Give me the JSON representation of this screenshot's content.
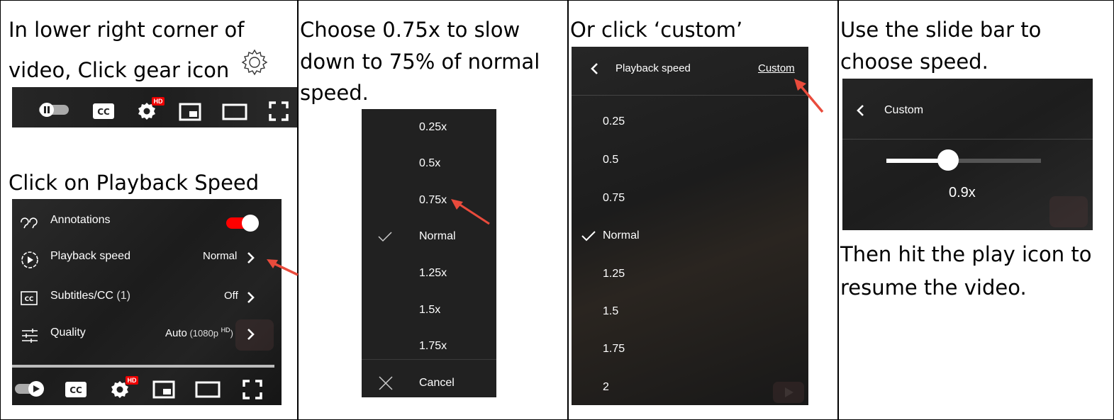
{
  "captions": {
    "p1_line1": "In lower right corner of",
    "p1_line2": "video, Click gear icon",
    "p1_line3": "Click on Playback Speed",
    "p2_line1": "Choose 0.75x to slow",
    "p2_line2": "down to 75% of normal",
    "p2_line3": "speed.",
    "p3_line1": "Or click ‘custom’",
    "p4_line1": "Use the slide bar to",
    "p4_line2": "choose speed.",
    "p4_line3": "Then hit the play icon to",
    "p4_line4": "resume the video."
  },
  "controls": {
    "cc_label": "CC",
    "hd_badge": "HD"
  },
  "settings_menu": {
    "items": [
      {
        "label": "Annotations",
        "value": "",
        "icon": "annotations-icon"
      },
      {
        "label": "Playback speed",
        "value": "Normal",
        "icon": "playback-speed-icon"
      },
      {
        "label": "Subtitles/CC",
        "suffix": " (1)",
        "value": "Off",
        "icon": "subtitles-icon"
      },
      {
        "label": "Quality",
        "value": "Auto",
        "value_suffix": " (1080p ",
        "value_hd": "HD",
        "value_end": ")",
        "icon": "quality-icon"
      }
    ],
    "annotations_on": true
  },
  "speed_list": {
    "items": [
      "0.25x",
      "0.5x",
      "0.75x",
      "Normal",
      "1.25x",
      "1.5x",
      "1.75x"
    ],
    "selected": "Normal",
    "cancel": "Cancel"
  },
  "speed_panel": {
    "title": "Playback speed",
    "custom_link": "Custom",
    "items": [
      "0.25",
      "0.5",
      "0.75",
      "Normal",
      "1.25",
      "1.5",
      "1.75",
      "2"
    ],
    "selected": "Normal"
  },
  "custom_panel": {
    "title": "Custom",
    "value_label": "0.9x",
    "slider_level": 0.4
  },
  "colors": {
    "accent_red": "#e94b3c",
    "toggle_red": "#ff0000",
    "panel_bg": "#1f1f1f"
  }
}
